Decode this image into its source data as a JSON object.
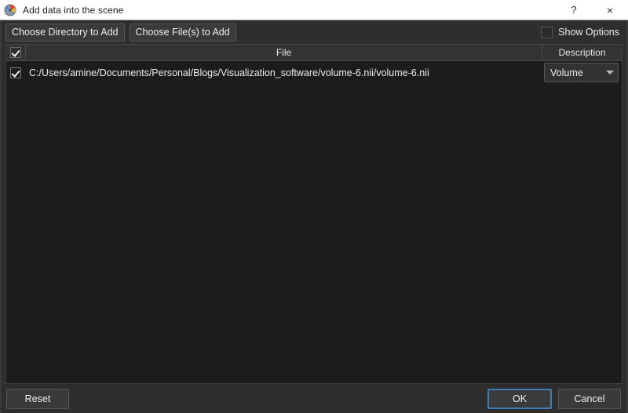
{
  "window": {
    "title": "Add data into the scene",
    "icon": "slicer-app-icon",
    "help_label": "?",
    "close_label": "×"
  },
  "toolbar": {
    "choose_directory_label": "Choose Directory to Add",
    "choose_files_label": "Choose File(s) to Add",
    "show_options_label": "Show Options",
    "show_options_checked": false
  },
  "table": {
    "headers": {
      "check": "",
      "file": "File",
      "description": "Description"
    },
    "header_check_checked": true,
    "rows": [
      {
        "checked": true,
        "file": "C:/Users/amine/Documents/Personal/Blogs/Visualization_software/volume-6.nii/volume-6.nii",
        "description": "Volume"
      }
    ]
  },
  "footer": {
    "reset_label": "Reset",
    "ok_label": "OK",
    "cancel_label": "Cancel"
  },
  "colors": {
    "window_background": "#2e2e2e",
    "titlebar_background": "#ffffff",
    "table_background": "#1c1c1c",
    "header_background": "#333333",
    "accent_focus": "#3d7eb8",
    "text": "#ededed"
  }
}
